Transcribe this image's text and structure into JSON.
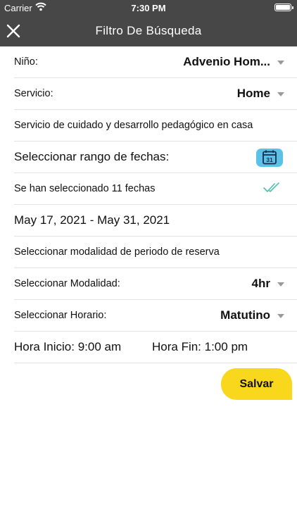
{
  "status_bar": {
    "carrier": "Carrier",
    "time": "7:30 PM"
  },
  "nav": {
    "title": "Filtro De Búsqueda",
    "close_icon": "close-icon"
  },
  "form": {
    "nino": {
      "label": "Niño:",
      "value": "Advenio Hom..."
    },
    "servicio": {
      "label": "Servicio:",
      "value": "Home"
    },
    "servicio_desc": "Servicio de cuidado y desarrollo pedagógico en casa",
    "rango_fechas": {
      "label": "Seleccionar rango de fechas:",
      "icon": "calendar-icon",
      "day": "31"
    },
    "fechas_seleccionadas": {
      "text": "Se han seleccionado 11 fechas",
      "icon": "double-check-icon"
    },
    "rango_texto": "May 17, 2021 - May 31, 2021",
    "modalidad_titulo": "Seleccionar modalidad de periodo de reserva",
    "modalidad": {
      "label": "Seleccionar Modalidad:",
      "value": "4hr"
    },
    "horario": {
      "label": "Seleccionar Horario:",
      "value": "Matutino"
    },
    "hora_inicio": "Hora Inicio: 9:00 am",
    "hora_fin": "Hora Fin: 1:00 pm"
  },
  "actions": {
    "save_label": "Salvar"
  },
  "colors": {
    "nav_bg": "#474747",
    "accent_blue": "#5bc2e7",
    "save_yellow": "#f9d71c",
    "check_teal": "#4fbfae"
  }
}
